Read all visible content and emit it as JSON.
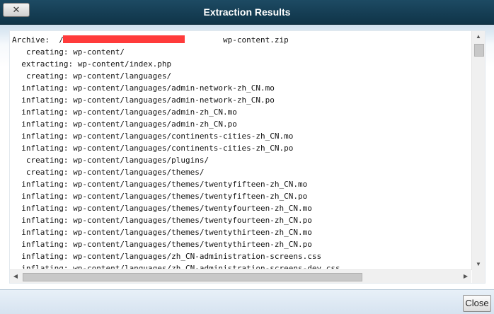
{
  "dialog": {
    "title": "Extraction Results",
    "close_icon_label": "✕",
    "close_button": "Close"
  },
  "log": {
    "lines": [
      "Archive:  /                                  wp-content.zip",
      "   creating: wp-content/",
      "  extracting: wp-content/index.php",
      "   creating: wp-content/languages/",
      "  inflating: wp-content/languages/admin-network-zh_CN.mo",
      "  inflating: wp-content/languages/admin-network-zh_CN.po",
      "  inflating: wp-content/languages/admin-zh_CN.mo",
      "  inflating: wp-content/languages/admin-zh_CN.po",
      "  inflating: wp-content/languages/continents-cities-zh_CN.mo",
      "  inflating: wp-content/languages/continents-cities-zh_CN.po",
      "   creating: wp-content/languages/plugins/",
      "   creating: wp-content/languages/themes/",
      "  inflating: wp-content/languages/themes/twentyfifteen-zh_CN.mo",
      "  inflating: wp-content/languages/themes/twentyfifteen-zh_CN.po",
      "  inflating: wp-content/languages/themes/twentyfourteen-zh_CN.mo",
      "  inflating: wp-content/languages/themes/twentyfourteen-zh_CN.po",
      "  inflating: wp-content/languages/themes/twentythirteen-zh_CN.mo",
      "  inflating: wp-content/languages/themes/twentythirteen-zh_CN.po",
      "  inflating: wp-content/languages/zh_CN-administration-screens.css",
      "  inflating: wp-content/languages/zh_CN-administration-screens-dev.css"
    ]
  },
  "scrollbars": {
    "up_arrow": "▲",
    "down_arrow": "▼",
    "left_arrow": "◀",
    "right_arrow": "▶"
  }
}
